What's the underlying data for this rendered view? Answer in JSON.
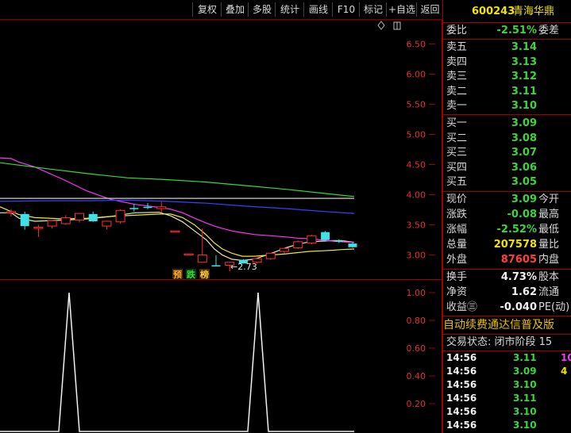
{
  "toolbar": {
    "buttons": [
      "复权",
      "叠加",
      "多股",
      "统计",
      "画线",
      "F10",
      "标记",
      "+自选",
      "返回"
    ]
  },
  "stock": {
    "code": "600243",
    "name": "青海华鼎"
  },
  "quote": {
    "weibi_label": "委比",
    "weibi_value": "-2.51%",
    "weicha_label": "委差",
    "asks": [
      {
        "label": "卖五",
        "price": "3.14"
      },
      {
        "label": "卖四",
        "price": "3.13"
      },
      {
        "label": "卖三",
        "price": "3.12"
      },
      {
        "label": "卖二",
        "price": "3.11"
      },
      {
        "label": "卖一",
        "price": "3.10"
      }
    ],
    "bids": [
      {
        "label": "买一",
        "price": "3.09"
      },
      {
        "label": "买二",
        "price": "3.08"
      },
      {
        "label": "买三",
        "price": "3.07"
      },
      {
        "label": "买四",
        "price": "3.06"
      },
      {
        "label": "买五",
        "price": "3.05"
      }
    ],
    "stats": [
      {
        "label": "现价",
        "value": "3.09",
        "label2": "今开",
        "color": "green"
      },
      {
        "label": "涨跌",
        "value": "-0.08",
        "label2": "最高",
        "color": "green"
      },
      {
        "label": "涨幅",
        "value": "-2.52%",
        "label2": "最低",
        "color": "green"
      },
      {
        "label": "总量",
        "value": "207578",
        "label2": "量比",
        "color": "yellow"
      },
      {
        "label": "外盘",
        "value": "87605",
        "label2": "内盘",
        "color": "red"
      }
    ],
    "stats2": [
      {
        "label": "换手",
        "value": "4.73%",
        "label2": "股本"
      },
      {
        "label": "净资",
        "value": "1.62",
        "label2": "流通"
      },
      {
        "label": "收益㊂",
        "value": "-0.040",
        "label2": "PE(动)"
      }
    ],
    "promo": "自动续费通达信普及版",
    "trade_state": "交易状态: 闭市阶段 15"
  },
  "ticks": [
    {
      "time": "14:56",
      "price": "3.11",
      "vol": "10",
      "pc": "green",
      "vc": "magenta"
    },
    {
      "time": "14:56",
      "price": "3.09",
      "vol": "4",
      "pc": "green",
      "vc": "yellow"
    },
    {
      "time": "14:56",
      "price": "3.10",
      "vol": "",
      "pc": "green",
      "vc": "yellow"
    },
    {
      "time": "14:56",
      "price": "3.11",
      "vol": "",
      "pc": "green",
      "vc": "yellow"
    },
    {
      "time": "14:56",
      "price": "3.10",
      "vol": "",
      "pc": "green",
      "vc": "yellow"
    },
    {
      "time": "14:56",
      "price": "3.10",
      "vol": "",
      "pc": "green",
      "vc": "yellow"
    }
  ],
  "chart_data": [
    {
      "type": "candlestick",
      "y_ticks": [
        "6.50",
        "6.00",
        "5.50",
        "5.00",
        "4.50",
        "4.00",
        "3.50",
        "3.00"
      ],
      "ylim": [
        2.6,
        6.9
      ],
      "low_label": "←2.73",
      "badges": [
        "预",
        "跌",
        "榜"
      ],
      "candles": [
        {
          "o": 3.7,
          "h": 3.76,
          "l": 3.64,
          "c": 3.72
        },
        {
          "o": 3.68,
          "h": 3.72,
          "l": 3.42,
          "c": 3.48
        },
        {
          "o": 3.46,
          "h": 3.5,
          "l": 3.3,
          "c": 3.46
        },
        {
          "o": 3.48,
          "h": 3.58,
          "l": 3.44,
          "c": 3.57
        },
        {
          "o": 3.52,
          "h": 3.66,
          "l": 3.5,
          "c": 3.62
        },
        {
          "o": 3.58,
          "h": 3.7,
          "l": 3.54,
          "c": 3.69
        },
        {
          "o": 3.68,
          "h": 3.72,
          "l": 3.55,
          "c": 3.56
        },
        {
          "o": 3.48,
          "h": 3.57,
          "l": 3.42,
          "c": 3.56
        },
        {
          "o": 3.55,
          "h": 3.76,
          "l": 3.52,
          "c": 3.74
        },
        {
          "o": 3.78,
          "h": 3.84,
          "l": 3.72,
          "c": 3.77
        },
        {
          "o": 3.8,
          "h": 3.86,
          "l": 3.76,
          "c": 3.78
        },
        {
          "o": 3.77,
          "h": 3.88,
          "l": 3.7,
          "c": 3.8
        },
        {
          "o": 3.4,
          "h": 3.4,
          "l": 3.4,
          "c": 3.4
        },
        {
          "o": 3.02,
          "h": 3.02,
          "l": 3.02,
          "c": 3.02
        },
        {
          "o": 2.88,
          "h": 3.44,
          "l": 2.88,
          "c": 3.0
        },
        {
          "o": 2.83,
          "h": 3.0,
          "l": 2.82,
          "c": 2.82
        },
        {
          "o": 2.83,
          "h": 2.88,
          "l": 2.73,
          "c": 2.88
        },
        {
          "o": 2.92,
          "h": 2.93,
          "l": 2.86,
          "c": 2.86
        },
        {
          "o": 2.88,
          "h": 2.96,
          "l": 2.86,
          "c": 2.94
        },
        {
          "o": 2.94,
          "h": 3.04,
          "l": 2.92,
          "c": 3.03
        },
        {
          "o": 3.06,
          "h": 3.12,
          "l": 3.02,
          "c": 3.11
        },
        {
          "o": 3.12,
          "h": 3.24,
          "l": 3.1,
          "c": 3.22
        },
        {
          "o": 3.2,
          "h": 3.34,
          "l": 3.18,
          "c": 3.32
        },
        {
          "o": 3.38,
          "h": 3.4,
          "l": 3.22,
          "c": 3.25
        },
        {
          "o": 3.24,
          "h": 3.26,
          "l": 3.2,
          "c": 3.22
        },
        {
          "o": 3.19,
          "h": 3.22,
          "l": 3.12,
          "c": 3.13
        }
      ],
      "series": [
        {
          "color": "#e8e8a0",
          "values": [
            [
              0,
              3.7
            ],
            [
              14,
              3.7
            ],
            [
              24,
              3.61
            ],
            [
              44,
              3.56
            ],
            [
              80,
              3.58
            ],
            [
              110,
              3.6
            ],
            [
              140,
              3.64
            ],
            [
              170,
              3.7
            ],
            [
              200,
              3.71
            ],
            [
              215,
              3.65
            ],
            [
              230,
              3.55
            ],
            [
              245,
              3.4
            ],
            [
              260,
              3.25
            ],
            [
              270,
              3.1
            ],
            [
              280,
              3.0
            ],
            [
              292,
              2.93
            ],
            [
              305,
              2.91
            ],
            [
              320,
              2.93
            ],
            [
              340,
              3.02
            ],
            [
              360,
              3.12
            ],
            [
              375,
              3.18
            ],
            [
              390,
              3.22
            ],
            [
              405,
              3.23
            ],
            [
              420,
              3.24
            ],
            [
              430,
              3.24
            ],
            [
              446,
              3.21
            ]
          ]
        },
        {
          "color": "#e8e840",
          "values": [
            [
              0,
              3.8
            ],
            [
              14,
              3.72
            ],
            [
              24,
              3.67
            ],
            [
              44,
              3.62
            ],
            [
              80,
              3.6
            ],
            [
              110,
              3.61
            ],
            [
              140,
              3.64
            ],
            [
              170,
              3.66
            ],
            [
              200,
              3.68
            ],
            [
              215,
              3.68
            ],
            [
              230,
              3.62
            ],
            [
              245,
              3.5
            ],
            [
              260,
              3.33
            ],
            [
              270,
              3.2
            ],
            [
              280,
              3.1
            ],
            [
              292,
              3.03
            ],
            [
              305,
              2.98
            ],
            [
              320,
              2.98
            ],
            [
              340,
              3.0
            ],
            [
              360,
              3.02
            ],
            [
              375,
              3.04
            ],
            [
              390,
              3.06
            ],
            [
              405,
              3.07
            ],
            [
              420,
              3.08
            ],
            [
              430,
              3.09
            ],
            [
              446,
              3.1
            ]
          ]
        },
        {
          "color": "#ff33ff",
          "values": [
            [
              0,
              4.61
            ],
            [
              14,
              4.6
            ],
            [
              24,
              4.54
            ],
            [
              44,
              4.46
            ],
            [
              80,
              4.25
            ],
            [
              110,
              4.06
            ],
            [
              140,
              3.92
            ],
            [
              170,
              3.84
            ],
            [
              200,
              3.79
            ],
            [
              215,
              3.76
            ],
            [
              230,
              3.7
            ],
            [
              245,
              3.61
            ],
            [
              260,
              3.53
            ],
            [
              270,
              3.48
            ],
            [
              280,
              3.44
            ],
            [
              292,
              3.4
            ],
            [
              305,
              3.37
            ],
            [
              320,
              3.34
            ],
            [
              340,
              3.32
            ],
            [
              360,
              3.3
            ],
            [
              375,
              3.28
            ],
            [
              390,
              3.27
            ],
            [
              405,
              3.25
            ],
            [
              420,
              3.23
            ],
            [
              430,
              3.22
            ],
            [
              446,
              3.21
            ]
          ]
        },
        {
          "color": "#33dd33",
          "values": [
            [
              0,
              4.53
            ],
            [
              60,
              4.43
            ],
            [
              110,
              4.35
            ],
            [
              160,
              4.28
            ],
            [
              210,
              4.25
            ],
            [
              260,
              4.21
            ],
            [
              310,
              4.15
            ],
            [
              360,
              4.09
            ],
            [
              410,
              4.02
            ],
            [
              446,
              3.97
            ]
          ]
        },
        {
          "color": "#3344ff",
          "values": [
            [
              0,
              3.89
            ],
            [
              60,
              3.9
            ],
            [
              110,
              3.9
            ],
            [
              160,
              3.91
            ],
            [
              210,
              3.89
            ],
            [
              260,
              3.86
            ],
            [
              310,
              3.81
            ],
            [
              360,
              3.77
            ],
            [
              410,
              3.72
            ],
            [
              446,
              3.69
            ]
          ]
        },
        {
          "color": "#d0d0d0",
          "values": [
            [
              0,
              3.94
            ],
            [
              60,
              3.94
            ],
            [
              110,
              3.94
            ],
            [
              160,
              3.94
            ],
            [
              210,
              3.94
            ],
            [
              260,
              3.94
            ],
            [
              310,
              3.94
            ],
            [
              360,
              3.94
            ],
            [
              410,
              3.94
            ],
            [
              446,
              3.94
            ]
          ]
        }
      ]
    },
    {
      "type": "line",
      "y_ticks": [
        "1.00",
        "0.80",
        "0.60",
        "0.40",
        "0.20"
      ],
      "ylim": [
        0,
        1.08
      ],
      "values": [
        [
          0,
          0
        ],
        [
          74,
          0
        ],
        [
          87,
          1
        ],
        [
          100,
          0
        ],
        [
          312,
          0
        ],
        [
          325,
          1
        ],
        [
          338,
          0
        ],
        [
          446,
          0
        ]
      ]
    }
  ]
}
